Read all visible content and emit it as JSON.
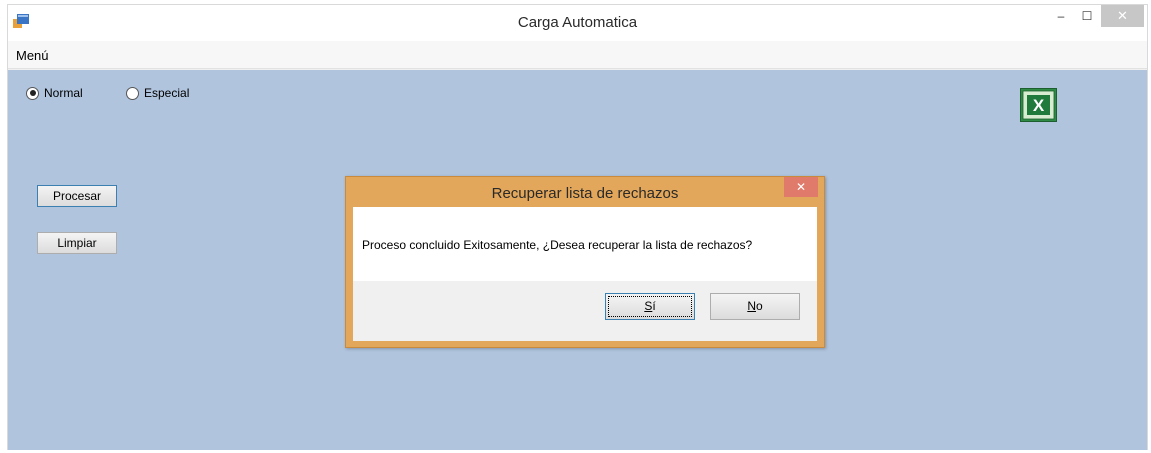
{
  "window": {
    "title": "Carga Automatica",
    "min_label": "–",
    "max_label": "☐",
    "close_label": "✕"
  },
  "menu": {
    "items": [
      {
        "label": "Menú"
      }
    ]
  },
  "options": {
    "normal_label": "Normal",
    "especial_label": "Especial",
    "selected": "Normal"
  },
  "buttons": {
    "procesar_label": "Procesar",
    "limpiar_label": "Limpiar"
  },
  "excel": {
    "icon": "excel-icon",
    "glyph": "X",
    "color": "#1f7a3b"
  },
  "dialog": {
    "title": "Recuperar lista de rechazos",
    "close_label": "✕",
    "message": "Proceso concluido Exitosamente, ¿Desea recuperar la lista de rechazos?",
    "yes_mnemonic": "S",
    "yes_rest": "í",
    "no_mnemonic": "N",
    "no_rest": "o"
  },
  "colors": {
    "client_bg": "#b0c4de",
    "dialog_frame": "#e3a75b",
    "dialog_close": "#e07a6a"
  }
}
